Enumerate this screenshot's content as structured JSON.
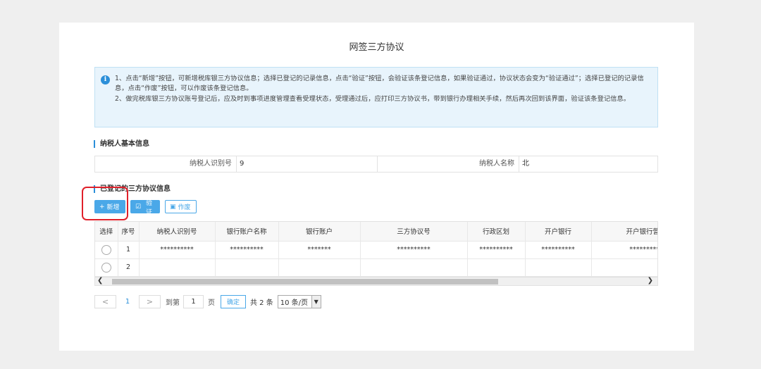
{
  "page": {
    "title": "网签三方协议"
  },
  "notice": {
    "lines": [
      "1、点击“新增”按钮，可新增税库银三方协议信息；选择已登记的记录信息，点击“验证”按钮，会验证该条登记信息，如果验证通过，协议状态会变为“验证通过”；选择已登记的记录信息，点击“作废”按钮，可以作废该条登记信息。",
      "2、做完税库银三方协议账号登记后，应及时到事项进度管理查看受理状态，受理通过后，应打印三方协议书，带到银行办理相关手续，然后再次回到该界面，验证该条登记信息。"
    ]
  },
  "taxpayer": {
    "section_title": "纳税人基本信息",
    "id_label": "纳税人识别号",
    "id_value": "9",
    "name_label": "纳税人名称",
    "name_value": "北"
  },
  "agreements": {
    "section_title": "已登记的三方协议信息",
    "buttons": {
      "add": "新增",
      "verify": "验证",
      "void": "作废"
    },
    "columns": [
      "选择",
      "序号",
      "纳税人识别号",
      "银行账户名称",
      "银行账户",
      "三方协议号",
      "行政区划",
      "开户银行",
      "开户银行营业"
    ],
    "rows": [
      [
        "",
        "1",
        "**********",
        "**********",
        "*******",
        "**********",
        "**********",
        "**********",
        "**********"
      ],
      [
        "",
        "2",
        "",
        "",
        "",
        "",
        "",
        "",
        ""
      ]
    ]
  },
  "pager": {
    "prev": "<",
    "current": "1",
    "next": ">",
    "goto_label": "到第",
    "goto_value": "1",
    "page_unit": "页",
    "confirm": "确定",
    "total": "共 2 条",
    "page_size": "10 条/页"
  }
}
